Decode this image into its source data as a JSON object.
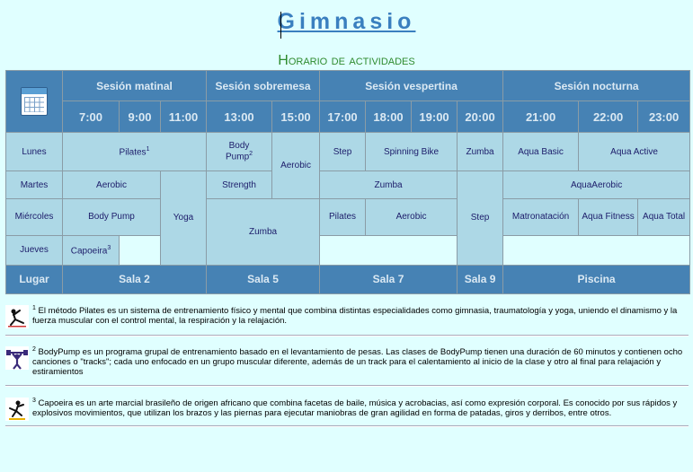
{
  "title": "Gimnasio",
  "subtitle": "Horario de actividades",
  "sessions": [
    "Sesión matinal",
    "Sesión sobremesa",
    "Sesión vespertina",
    "Sesión nocturna"
  ],
  "hours": [
    "7:00",
    "9:00",
    "11:00",
    "13:00",
    "15:00",
    "17:00",
    "18:00",
    "19:00",
    "20:00",
    "21:00",
    "22:00",
    "23:00"
  ],
  "days": [
    "Lunes",
    "Martes",
    "Miércoles",
    "Jueves"
  ],
  "activities": {
    "pilates": "Pilates",
    "body_pump_a": "Body",
    "body_pump_b": "Pump",
    "aerobic_1": "Aerobic",
    "step_1": "Step",
    "spinning": "Spinning Bike",
    "zumba_1": "Zumba",
    "aqua_basic": "Aqua Basic",
    "aqua_active": "Aqua Active",
    "aerobic_2": "Aerobic",
    "yoga": "Yoga",
    "strength": "Strength",
    "zumba_2": "Zumba",
    "step_2": "Step",
    "aquaaerobic": "AquaAerobic",
    "body_pump_full": "Body Pump",
    "zumba_3": "Zumba",
    "pilates_2": "Pilates",
    "aerobic_3": "Aerobic",
    "matronatacion": "Matronatación",
    "aqua_fitness": "Aqua Fitness",
    "aqua_total": "Aqua Total",
    "capoeira": "Capoeira"
  },
  "sups": {
    "one": "1",
    "two": "2",
    "three": "3"
  },
  "footer": {
    "label": "Lugar",
    "rooms": [
      "Sala 2",
      "Sala 5",
      "Sala 7",
      "Sala 9",
      "Piscina"
    ]
  },
  "notes": [
    {
      "num": "1",
      "text": "El método Pilates es un sistema de entrenamiento físico y mental que combina distintas especialidades como gimnasia, traumatología y yoga, uniendo el dinamismo y la fuerza muscular con el control mental, la respiración y la relajación."
    },
    {
      "num": "2",
      "text": "BodyPump es un programa grupal de entrenamiento basado en el levantamiento de pesas. Las clases de BodyPump tienen una duración de 60 minutos y contienen ocho canciones o \"tracks\"; cada uno enfocado en un grupo muscular diferente, además de un track para el calentamiento al inicio de la clase y otro al final para relajación y estiramientos"
    },
    {
      "num": "3",
      "text": "Capoeira es un arte marcial brasileño de origen africano que combina facetas de baile, música y acrobacias, así como expresión corporal. Es conocido por sus rápidos y explosivos movimientos, que utilizan los brazos y las piernas para ejecutar maniobras de gran agilidad en forma de patadas, giros y derribos, entre otros."
    }
  ]
}
